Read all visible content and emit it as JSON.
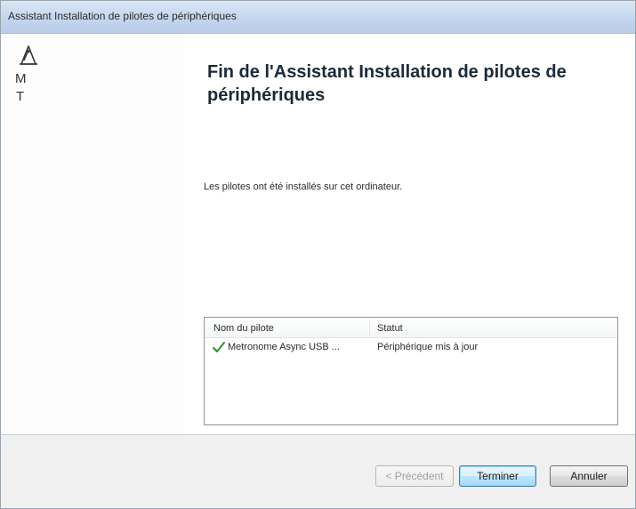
{
  "window": {
    "title": "Assistant Installation de pilotes de périphériques"
  },
  "sidebar": {
    "logo_icon": "metronome-logo-icon",
    "logo_letters": [
      "M",
      "T"
    ]
  },
  "main": {
    "heading": "Fin de l'Assistant Installation de pilotes de périphériques",
    "message": "Les pilotes ont été installés sur cet ordinateur."
  },
  "driver_list": {
    "columns": [
      "Nom du pilote",
      "Statut"
    ],
    "rows": [
      {
        "status_icon": "checkmark-icon",
        "name": "Metronome Async USB ...",
        "status": "Périphérique mis à jour"
      }
    ]
  },
  "buttons": {
    "back": "< Précédent",
    "finish": "Terminer",
    "cancel": "Annuler"
  },
  "colors": {
    "check": "#2e8b2e",
    "default_button_border": "#3c7fb1"
  }
}
